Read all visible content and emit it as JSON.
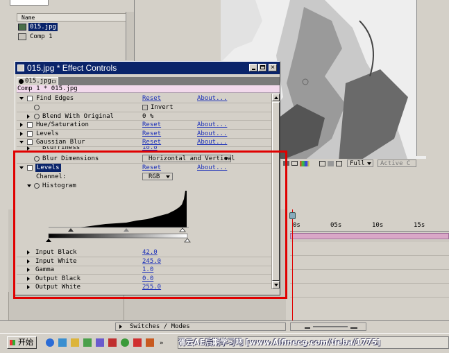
{
  "project": {
    "column_header": "Name",
    "items": [
      {
        "name": "015.jpg",
        "selected": true
      },
      {
        "name": "Comp 1",
        "selected": false
      }
    ]
  },
  "effect_controls": {
    "title": "015.jpg * Effect Controls",
    "tab_label": "015.jpg",
    "path_label": "Comp 1 * 015.jpg",
    "reset_label": "Reset",
    "about_label": "About...",
    "find_edges": {
      "name": "Find Edges",
      "invert_label": "Invert",
      "blend_label": "Blend With Original",
      "blend_value": "0 %"
    },
    "effects": [
      "Hue/Saturation",
      "Levels",
      "Gaussian Blur"
    ],
    "blurriness_label": "Blurriness",
    "blurriness_value": "10.0",
    "blur_dimensions_label": "Blur Dimensions",
    "blur_dimensions_value": "Horizontal and Vertical",
    "levels": {
      "name": "Levels",
      "channel_label": "Channel:",
      "channel_value": "RGB",
      "histogram_label": "Histogram",
      "params": [
        {
          "label": "Input Black",
          "value": "42.0"
        },
        {
          "label": "Input White",
          "value": "245.0"
        },
        {
          "label": "Gamma",
          "value": "1.0"
        },
        {
          "label": "Output Black",
          "value": "0.0"
        },
        {
          "label": "Output White",
          "value": "255.0"
        }
      ]
    }
  },
  "comp_viewer": {
    "resolution": "Full",
    "active_camera": "Active C"
  },
  "timeline": {
    "ruler": [
      "0s",
      "05s",
      "10s",
      "15s"
    ],
    "switches_label": "Switches / Modes"
  },
  "taskbar": {
    "start_label": "开始",
    "watermark_text": "胥云AE后期学习吧 [www.Alfinecg.com/tieba/1775]"
  },
  "colors": {
    "title_bar": "#0a246a",
    "highlight_border": "#e00000",
    "link": "#1b2fb8",
    "time_marker": "#e00000",
    "work_area": "#d9a7c7"
  }
}
